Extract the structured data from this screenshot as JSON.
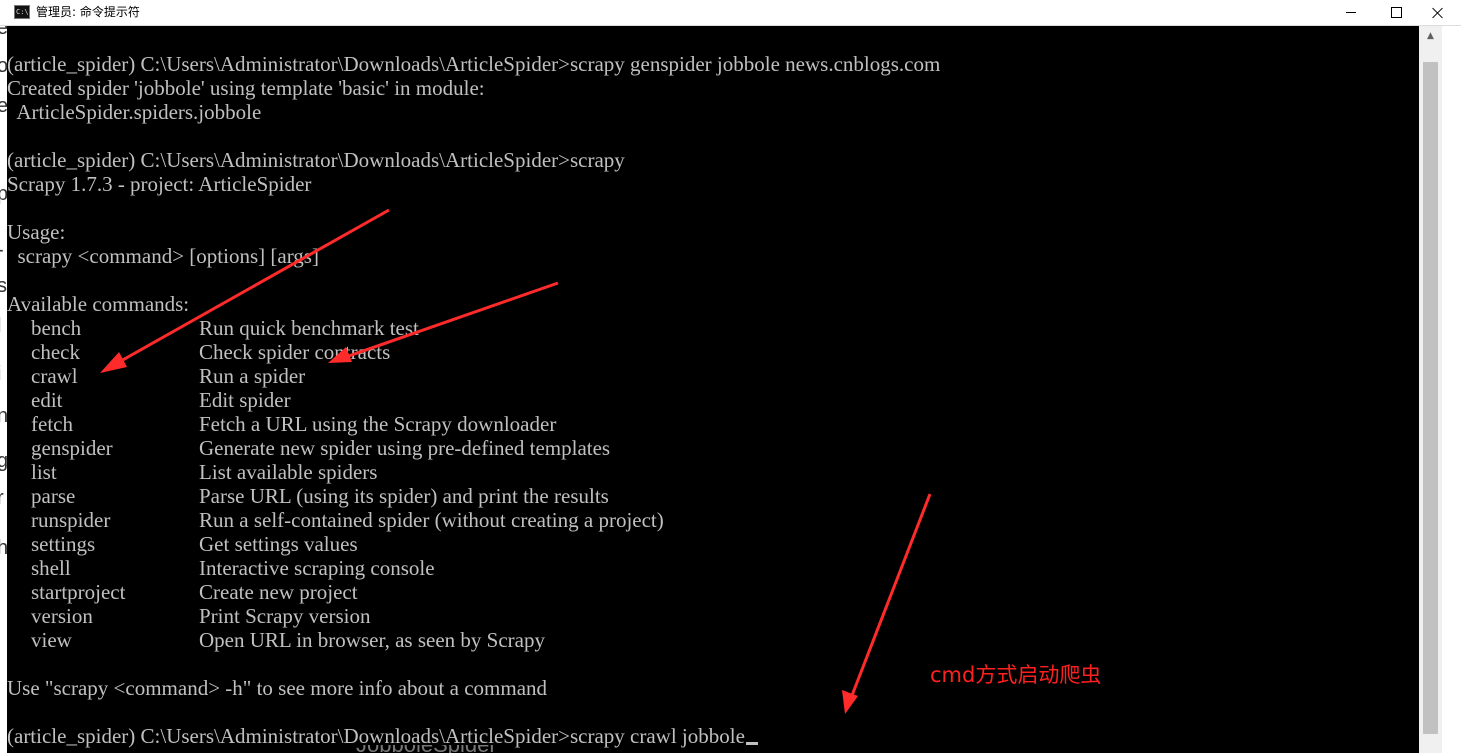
{
  "window": {
    "title": "管理员: 命令提示符",
    "icon": "cmd-icon",
    "icon_text": "C:\\"
  },
  "left_strip": {
    "chars": [
      "e",
      "o",
      "e",
      "p",
      "-",
      "s",
      "l",
      "i",
      "n",
      "g",
      "r",
      "h"
    ]
  },
  "console": {
    "text_color": "#c0c0c0",
    "background": "#000000",
    "lines": [
      "(article_spider) C:\\Users\\Administrator\\Downloads\\ArticleSpider>scrapy genspider jobbole news.cnblogs.com",
      "Created spider 'jobbole' using template 'basic' in module:",
      "  ArticleSpider.spiders.jobbole",
      "",
      "(article_spider) C:\\Users\\Administrator\\Downloads\\ArticleSpider>scrapy",
      "Scrapy 1.7.3 - project: ArticleSpider",
      "",
      "Usage:",
      "  scrapy <command> [options] [args]",
      "",
      "Available commands:"
    ],
    "commands": [
      {
        "name": "bench",
        "desc": "Run quick benchmark test"
      },
      {
        "name": "check",
        "desc": "Check spider contracts"
      },
      {
        "name": "crawl",
        "desc": "Run a spider"
      },
      {
        "name": "edit",
        "desc": "Edit spider"
      },
      {
        "name": "fetch",
        "desc": "Fetch a URL using the Scrapy downloader"
      },
      {
        "name": "genspider",
        "desc": "Generate new spider using pre-defined templates"
      },
      {
        "name": "list",
        "desc": "List available spiders"
      },
      {
        "name": "parse",
        "desc": "Parse URL (using its spider) and print the results"
      },
      {
        "name": "runspider",
        "desc": "Run a self-contained spider (without creating a project)"
      },
      {
        "name": "settings",
        "desc": "Get settings values"
      },
      {
        "name": "shell",
        "desc": "Interactive scraping console"
      },
      {
        "name": "startproject",
        "desc": "Create new project"
      },
      {
        "name": "version",
        "desc": "Print Scrapy version"
      },
      {
        "name": "view",
        "desc": "Open URL in browser, as seen by Scrapy"
      }
    ],
    "help_line": "Use \"scrapy <command> -h\" to see more info about a command",
    "prompt_line": "(article_spider) C:\\Users\\Administrator\\Downloads\\ArticleSpider>scrapy crawl jobbole"
  },
  "annotation": {
    "text": "cmd方式启动爬虫",
    "color": "#ff2020"
  },
  "bottom_overlap_text": "JobboleSpider",
  "scrollbar": {
    "up_icon": "scroll-up-arrow-icon"
  },
  "colors": {
    "arrow": "#ff2a2a",
    "titlebar": "#ffffff"
  }
}
